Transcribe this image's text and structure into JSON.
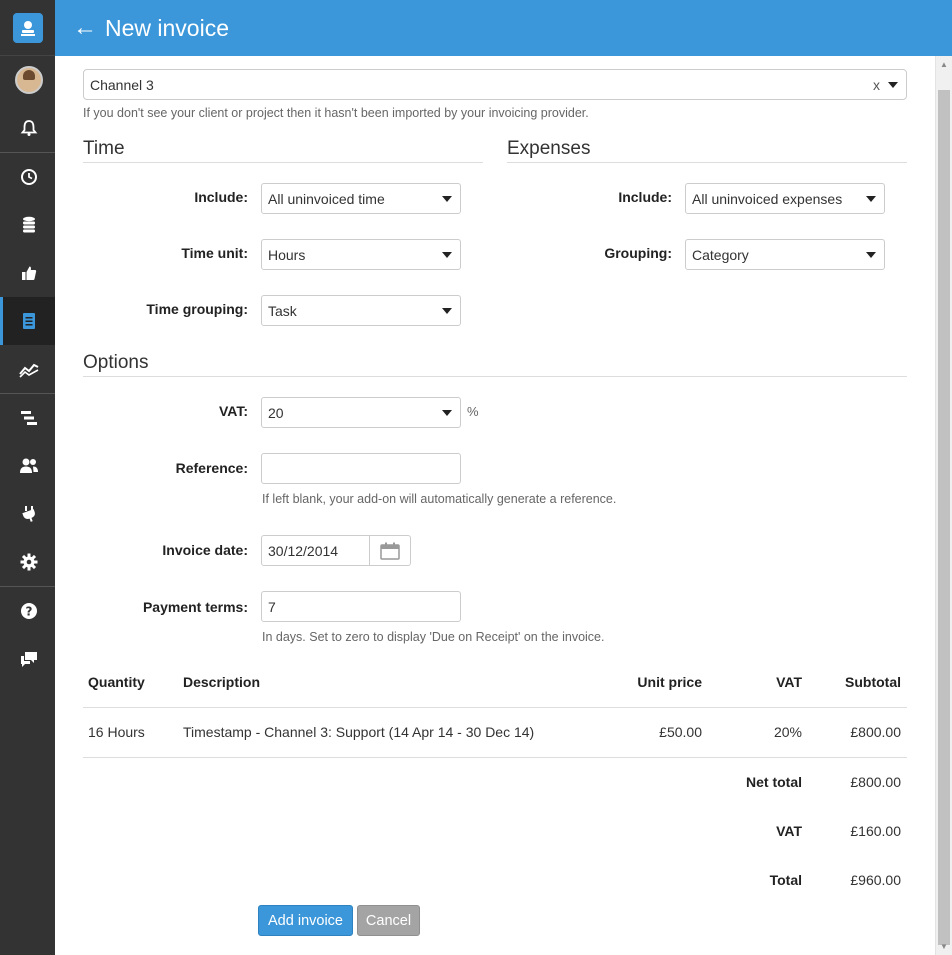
{
  "header": {
    "title": "New invoice",
    "back_icon": "arrow-left-icon"
  },
  "sidebar": {
    "items": [
      {
        "name": "bell-icon"
      },
      {
        "name": "clock-icon"
      },
      {
        "name": "database-icon"
      },
      {
        "name": "thumbs-up-icon"
      },
      {
        "name": "invoice-icon",
        "active": true
      },
      {
        "name": "chart-icon"
      },
      {
        "name": "tasks-icon"
      },
      {
        "name": "users-icon"
      },
      {
        "name": "plug-icon"
      },
      {
        "name": "gear-icon"
      },
      {
        "name": "help-icon"
      },
      {
        "name": "chat-icon"
      }
    ]
  },
  "client": {
    "value": "Channel 3",
    "clear": "x",
    "hint": "If you don't see your client or project then it hasn't been imported by your invoicing provider."
  },
  "time": {
    "title": "Time",
    "include_label": "Include:",
    "include_value": "All uninvoiced time",
    "unit_label": "Time unit:",
    "unit_value": "Hours",
    "grouping_label": "Time grouping:",
    "grouping_value": "Task"
  },
  "expenses": {
    "title": "Expenses",
    "include_label": "Include:",
    "include_value": "All uninvoiced expenses",
    "grouping_label": "Grouping:",
    "grouping_value": "Category"
  },
  "options": {
    "title": "Options",
    "vat_label": "VAT:",
    "vat_value": "20",
    "vat_unit": "%",
    "reference_label": "Reference:",
    "reference_value": "",
    "reference_hint": "If left blank, your add-on will automatically generate a reference.",
    "date_label": "Invoice date:",
    "date_value": "30/12/2014",
    "terms_label": "Payment terms:",
    "terms_value": "7",
    "terms_hint": "In days. Set to zero to display 'Due on Receipt' on the invoice."
  },
  "table": {
    "headers": {
      "quantity": "Quantity",
      "description": "Description",
      "unit_price": "Unit price",
      "vat": "VAT",
      "subtotal": "Subtotal"
    },
    "rows": [
      {
        "quantity": "16 Hours",
        "description": "Timestamp - Channel 3: Support (14 Apr 14 - 30 Dec 14)",
        "unit_price": "£50.00",
        "vat": "20%",
        "subtotal": "£800.00"
      }
    ],
    "totals": {
      "net_label": "Net total",
      "net_value": "£800.00",
      "vat_label": "VAT",
      "vat_value": "£160.00",
      "total_label": "Total",
      "total_value": "£960.00"
    }
  },
  "actions": {
    "add": "Add invoice",
    "cancel": "Cancel"
  },
  "colors": {
    "brand": "#3b97d9",
    "sidebar": "#333333"
  }
}
